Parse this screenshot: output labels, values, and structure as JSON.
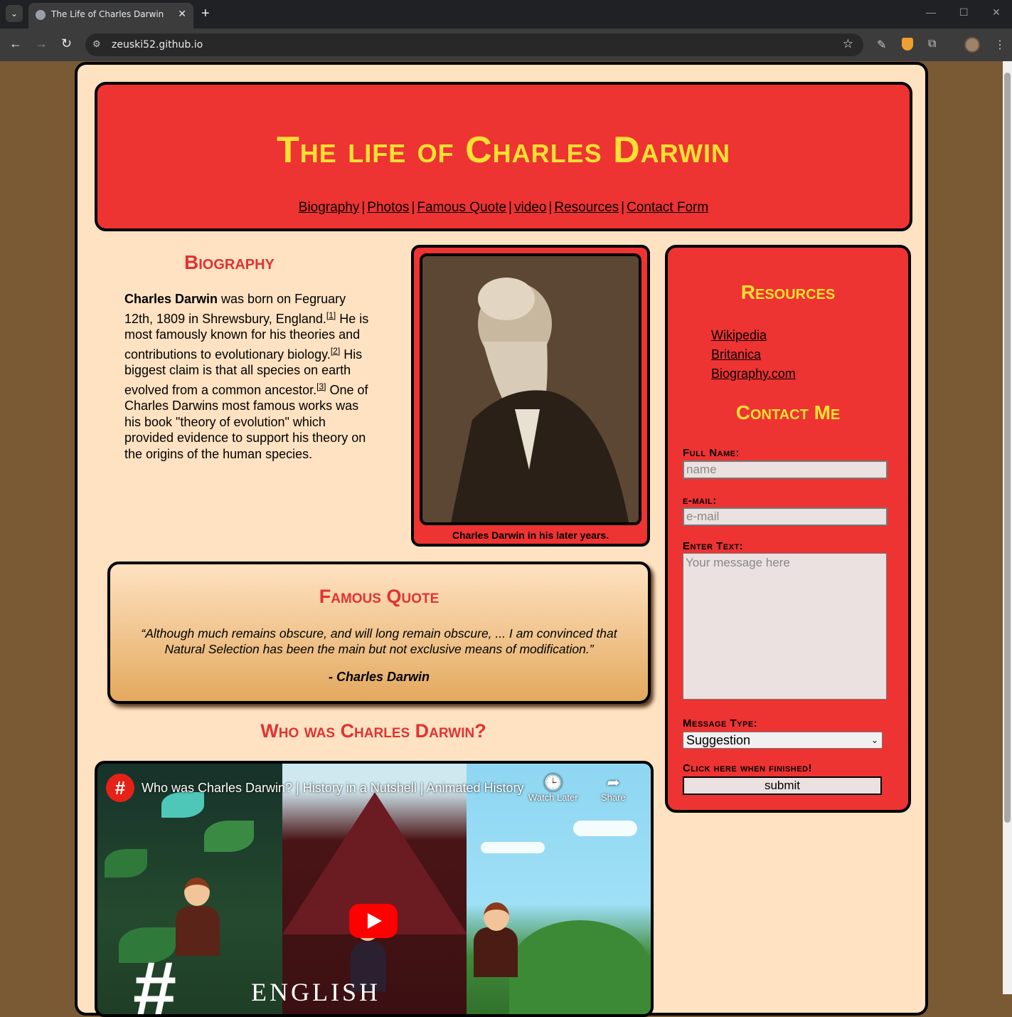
{
  "browser": {
    "tab_title": "The Life of Charles Darwin",
    "url": "zeuski52.github.io",
    "tab_close": "✕",
    "new_tab": "+",
    "back": "←",
    "forward": "→",
    "reload": "↻",
    "star": "☆",
    "minimize": "—",
    "maximize": "☐",
    "close": "✕",
    "tab_menu": "⌄"
  },
  "header": {
    "title": "The life of Charles Darwin",
    "nav": [
      "Biography",
      "Photos",
      "Famous Quote",
      "video",
      "Resources",
      "Contact Form"
    ],
    "separator": "|"
  },
  "biography": {
    "heading": "Biography",
    "name": "Charles Darwin",
    "text_1": " was born on Fegruary 12th, 1809 in Shrewsbury, England.",
    "ref_1": "[1]",
    "text_2": " He is most famously known for his theories and contributions to evolutionary biology.",
    "ref_2": "[2]",
    "text_3": " His biggest claim is that all species on earth evolved from a common ancestor.",
    "ref_3": "[3]",
    "text_4": " One of Charles Darwins most famous works was his book \"theory of evolution\" which provided evidence to support his theory on the origins of the human species."
  },
  "photo": {
    "caption": "Charles Darwin in his later years."
  },
  "quote": {
    "heading": "Famous Quote",
    "text": "“Although much remains obscure, and will long remain obscure, ... I am convinced that Natural Selection has been the main but not exclusive means of modification.”",
    "author": "- Charles Darwin"
  },
  "video": {
    "heading": "Who was Charles Darwin?",
    "title": "Who was Charles Darwin? | History in a Nutshell | Animated History",
    "watch_later": "Watch Later",
    "share": "Share",
    "channel_mark": "#",
    "brand_text": "ENGLISH"
  },
  "sidebar": {
    "resources_heading": "Resources",
    "resources": [
      "Wikipedia",
      "Britanica",
      "Biography.com"
    ],
    "contact_heading": "Contact Me",
    "full_name_label": "Full Name:",
    "full_name_placeholder": "name",
    "email_label": "e-mail:",
    "email_placeholder": "e-mail",
    "text_label": "Enter Text:",
    "text_placeholder": "Your message here",
    "type_label": "Message Type:",
    "type_selected": "Suggestion",
    "finish_label": "Click here when finished!",
    "submit_label": "submit"
  },
  "colors": {
    "page_bg": "#7a5a34",
    "content_bg": "#ffe2c2",
    "red": "#ee3333",
    "yellow": "#ffe033"
  }
}
